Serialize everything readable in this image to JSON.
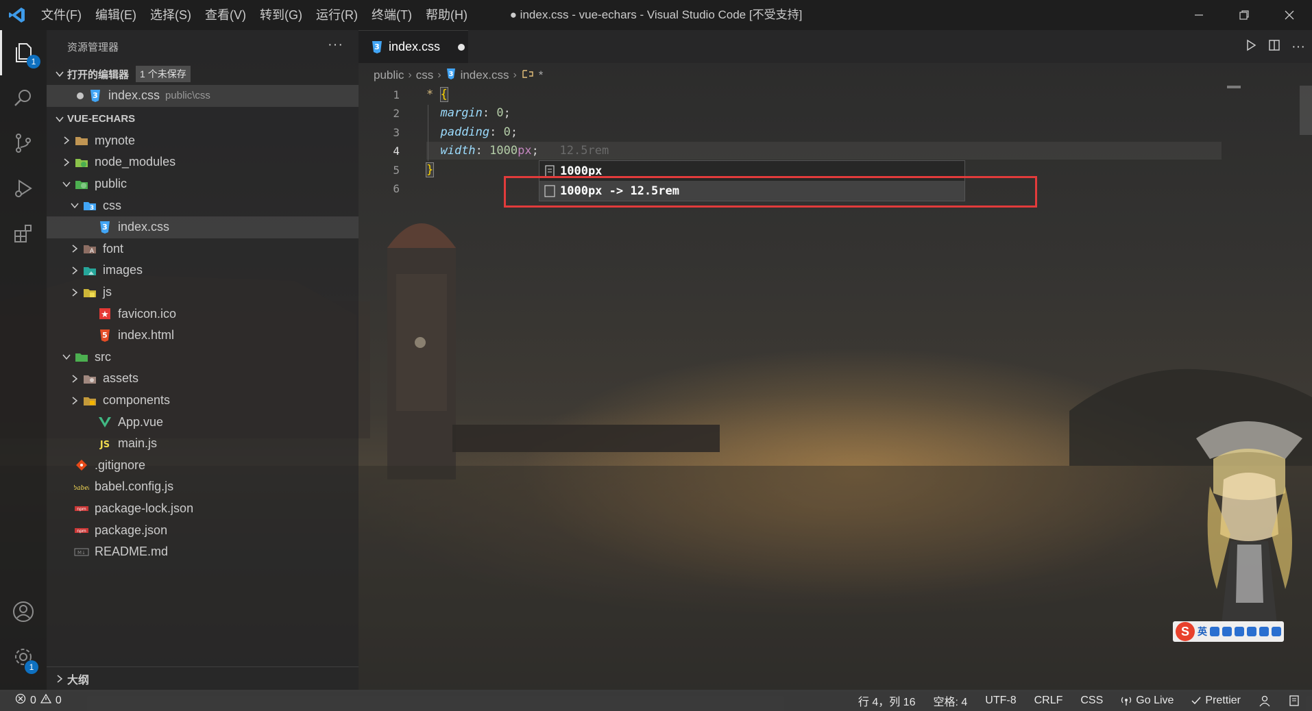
{
  "window": {
    "title": "● index.css - vue-echars - Visual Studio Code [不受支持]"
  },
  "menu": [
    "文件(F)",
    "编辑(E)",
    "选择(S)",
    "查看(V)",
    "转到(G)",
    "运行(R)",
    "终端(T)",
    "帮助(H)"
  ],
  "activity": {
    "explorer_badge": "1",
    "settings_badge": "1"
  },
  "sidebar": {
    "title": "资源管理器",
    "more": "···",
    "open_editors": {
      "label": "打开的编辑器",
      "badge": "1 个未保存",
      "file": "index.css",
      "file_path": "public\\css"
    },
    "project": {
      "label": "VUE-ECHARS",
      "items": [
        {
          "name": "mynote"
        },
        {
          "name": "node_modules"
        },
        {
          "name": "public"
        },
        {
          "name": "css"
        },
        {
          "name": "index.css"
        },
        {
          "name": "font"
        },
        {
          "name": "images"
        },
        {
          "name": "js"
        },
        {
          "name": "favicon.ico"
        },
        {
          "name": "index.html"
        },
        {
          "name": "src"
        },
        {
          "name": "assets"
        },
        {
          "name": "components"
        },
        {
          "name": "App.vue"
        },
        {
          "name": "main.js"
        },
        {
          "name": ".gitignore"
        },
        {
          "name": "babel.config.js"
        },
        {
          "name": "package-lock.json"
        },
        {
          "name": "package.json"
        },
        {
          "name": "README.md"
        }
      ]
    },
    "outline_label": "大纲"
  },
  "editor": {
    "tab_label": "index.css",
    "breadcrumb": [
      "public",
      "css",
      "index.css",
      "*"
    ],
    "line_numbers": [
      "1",
      "2",
      "3",
      "4",
      "5",
      "6"
    ],
    "code": {
      "l1_selector": "*",
      "l1_brace": "{",
      "l2_prop": "margin",
      "l2_value": "0",
      "l3_prop": "padding",
      "l3_value": "0",
      "l4_prop": "width",
      "l4_value": "1000",
      "l4_unit": "px",
      "l4_ghost": "12.5rem",
      "l5_brace": "}"
    },
    "suggestions": [
      "1000px",
      "1000px -> 12.5rem"
    ]
  },
  "ime": {
    "logo": "S",
    "mode": "英"
  },
  "statusbar": {
    "errors": "0",
    "warnings": "0",
    "position": "行 4，列 16",
    "indent": "空格: 4",
    "encoding": "UTF-8",
    "eol": "CRLF",
    "language": "CSS",
    "golive": "Go Live",
    "prettier": "Prettier"
  },
  "colors": {
    "accent": "#0e70c0",
    "highlight_box": "#e23b3b",
    "css_icon": "#42a5f5"
  }
}
